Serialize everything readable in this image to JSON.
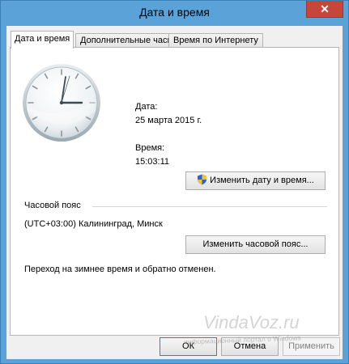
{
  "window": {
    "title": "Дата и время",
    "close_glyph": "✕",
    "frame_color": "#5aa2d8",
    "close_color": "#c7463c"
  },
  "tabs": [
    {
      "label": "Дата и время",
      "active": true
    },
    {
      "label": "Дополнительные часы",
      "active": false
    },
    {
      "label": "Время по Интернету",
      "active": false
    }
  ],
  "datetime": {
    "date_label": "Дата:",
    "date_value": "25 марта 2015 г.",
    "time_label": "Время:",
    "time_value": "15:03:11",
    "change_button": "Изменить дату и время..."
  },
  "timezone": {
    "section_label": "Часовой пояс",
    "value": "(UTC+03:00) Калининград, Минск",
    "change_button": "Изменить часовой пояс..."
  },
  "dst_note": "Переход на зимнее время и обратно отменен.",
  "footer": {
    "ok": "ОК",
    "cancel": "Отмена",
    "apply": "Применить"
  },
  "watermark": {
    "logo": "VindaVoz.ru",
    "caption": "информационный портал о Windows"
  },
  "icons": {
    "shield": "uac-shield-icon",
    "clock": "analog-clock-icon"
  }
}
